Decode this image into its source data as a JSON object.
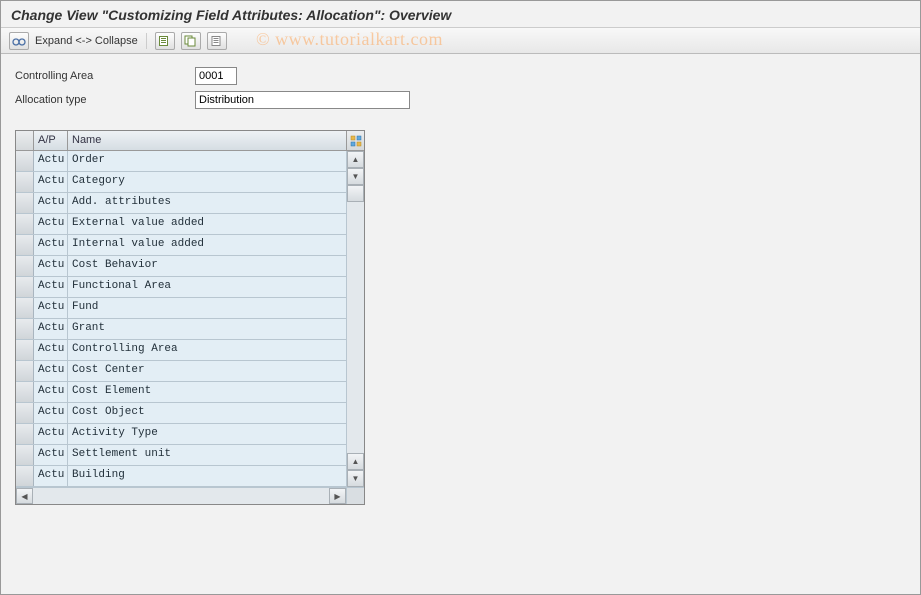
{
  "title": "Change View \"Customizing Field Attributes: Allocation\": Overview",
  "toolbar": {
    "expand_collapse": "Expand <-> Collapse"
  },
  "form": {
    "controlling_area": {
      "label": "Controlling Area",
      "value": "0001"
    },
    "allocation_type": {
      "label": "Allocation type",
      "value": "Distribution"
    }
  },
  "table": {
    "headers": {
      "ap": "A/P",
      "name": "Name"
    },
    "rows": [
      {
        "ap": "Actu",
        "name": "Order"
      },
      {
        "ap": "Actu",
        "name": "Category"
      },
      {
        "ap": "Actu",
        "name": "Add. attributes"
      },
      {
        "ap": "Actu",
        "name": "External value added"
      },
      {
        "ap": "Actu",
        "name": "Internal value added"
      },
      {
        "ap": "Actu",
        "name": "Cost Behavior"
      },
      {
        "ap": "Actu",
        "name": "Functional Area"
      },
      {
        "ap": "Actu",
        "name": "Fund"
      },
      {
        "ap": "Actu",
        "name": "Grant"
      },
      {
        "ap": "Actu",
        "name": "Controlling Area"
      },
      {
        "ap": "Actu",
        "name": "Cost Center"
      },
      {
        "ap": "Actu",
        "name": "Cost Element"
      },
      {
        "ap": "Actu",
        "name": "Cost Object"
      },
      {
        "ap": "Actu",
        "name": "Activity Type"
      },
      {
        "ap": "Actu",
        "name": "Settlement unit"
      },
      {
        "ap": "Actu",
        "name": "Building"
      }
    ]
  },
  "watermark": "© www.tutorialkart.com"
}
